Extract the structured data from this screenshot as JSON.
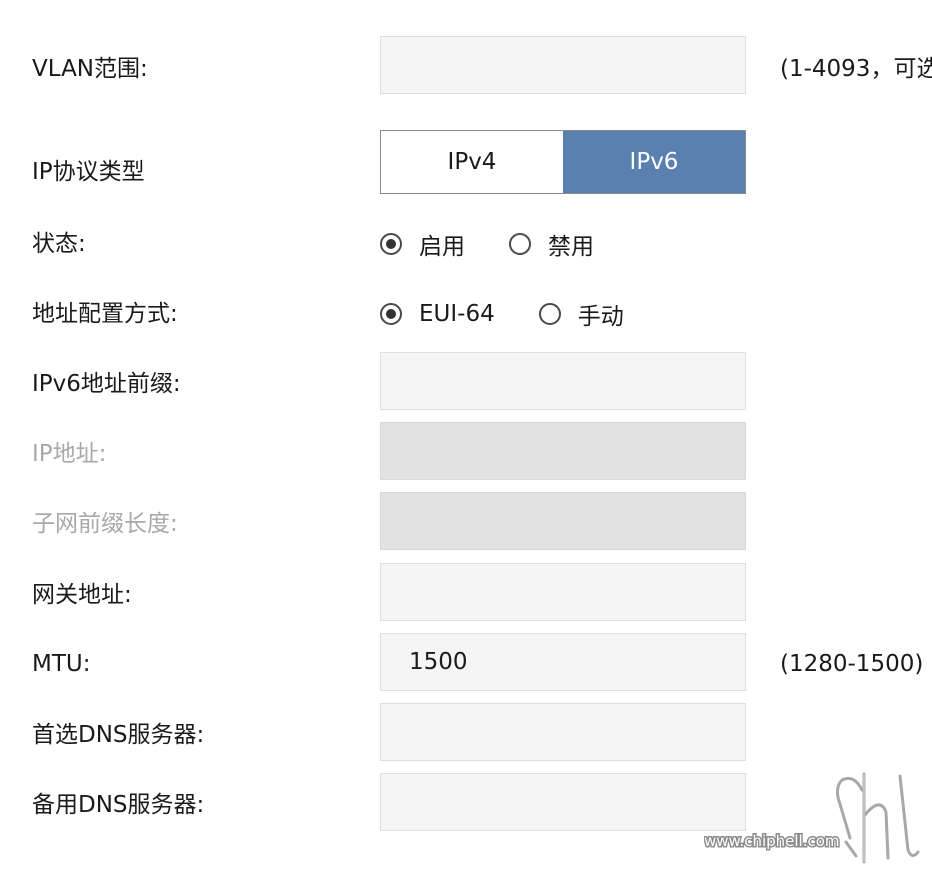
{
  "vlan": {
    "label": "VLAN范围:",
    "value": "",
    "hint": "(1-4093，可选"
  },
  "ip_protocol": {
    "label": "IP协议类型",
    "options": [
      "IPv4",
      "IPv6"
    ],
    "selected": "IPv6"
  },
  "status": {
    "label": "状态:",
    "options": [
      "启用",
      "禁用"
    ],
    "selected": "启用"
  },
  "addr_mode": {
    "label": "地址配置方式:",
    "options": [
      "EUI-64",
      "手动"
    ],
    "selected": "EUI-64"
  },
  "ipv6_prefix": {
    "label": "IPv6地址前缀:",
    "value": ""
  },
  "ip_address": {
    "label": "IP地址:",
    "value": ""
  },
  "prefix_length": {
    "label": "子网前缀长度:",
    "value": ""
  },
  "gateway": {
    "label": "网关地址:",
    "value": ""
  },
  "mtu": {
    "label": "MTU:",
    "value": "1500",
    "hint": "(1280-1500)"
  },
  "dns_primary": {
    "label": "首选DNS服务器:",
    "value": ""
  },
  "dns_secondary": {
    "label": "备用DNS服务器:",
    "value": ""
  },
  "watermark": {
    "text": "www.chiphell.com"
  },
  "colors": {
    "accent": "#5a80b0",
    "field_bg": "#f5f5f5",
    "field_disabled_bg": "#e2e2e2",
    "disabled_text": "#a9a9a9"
  }
}
